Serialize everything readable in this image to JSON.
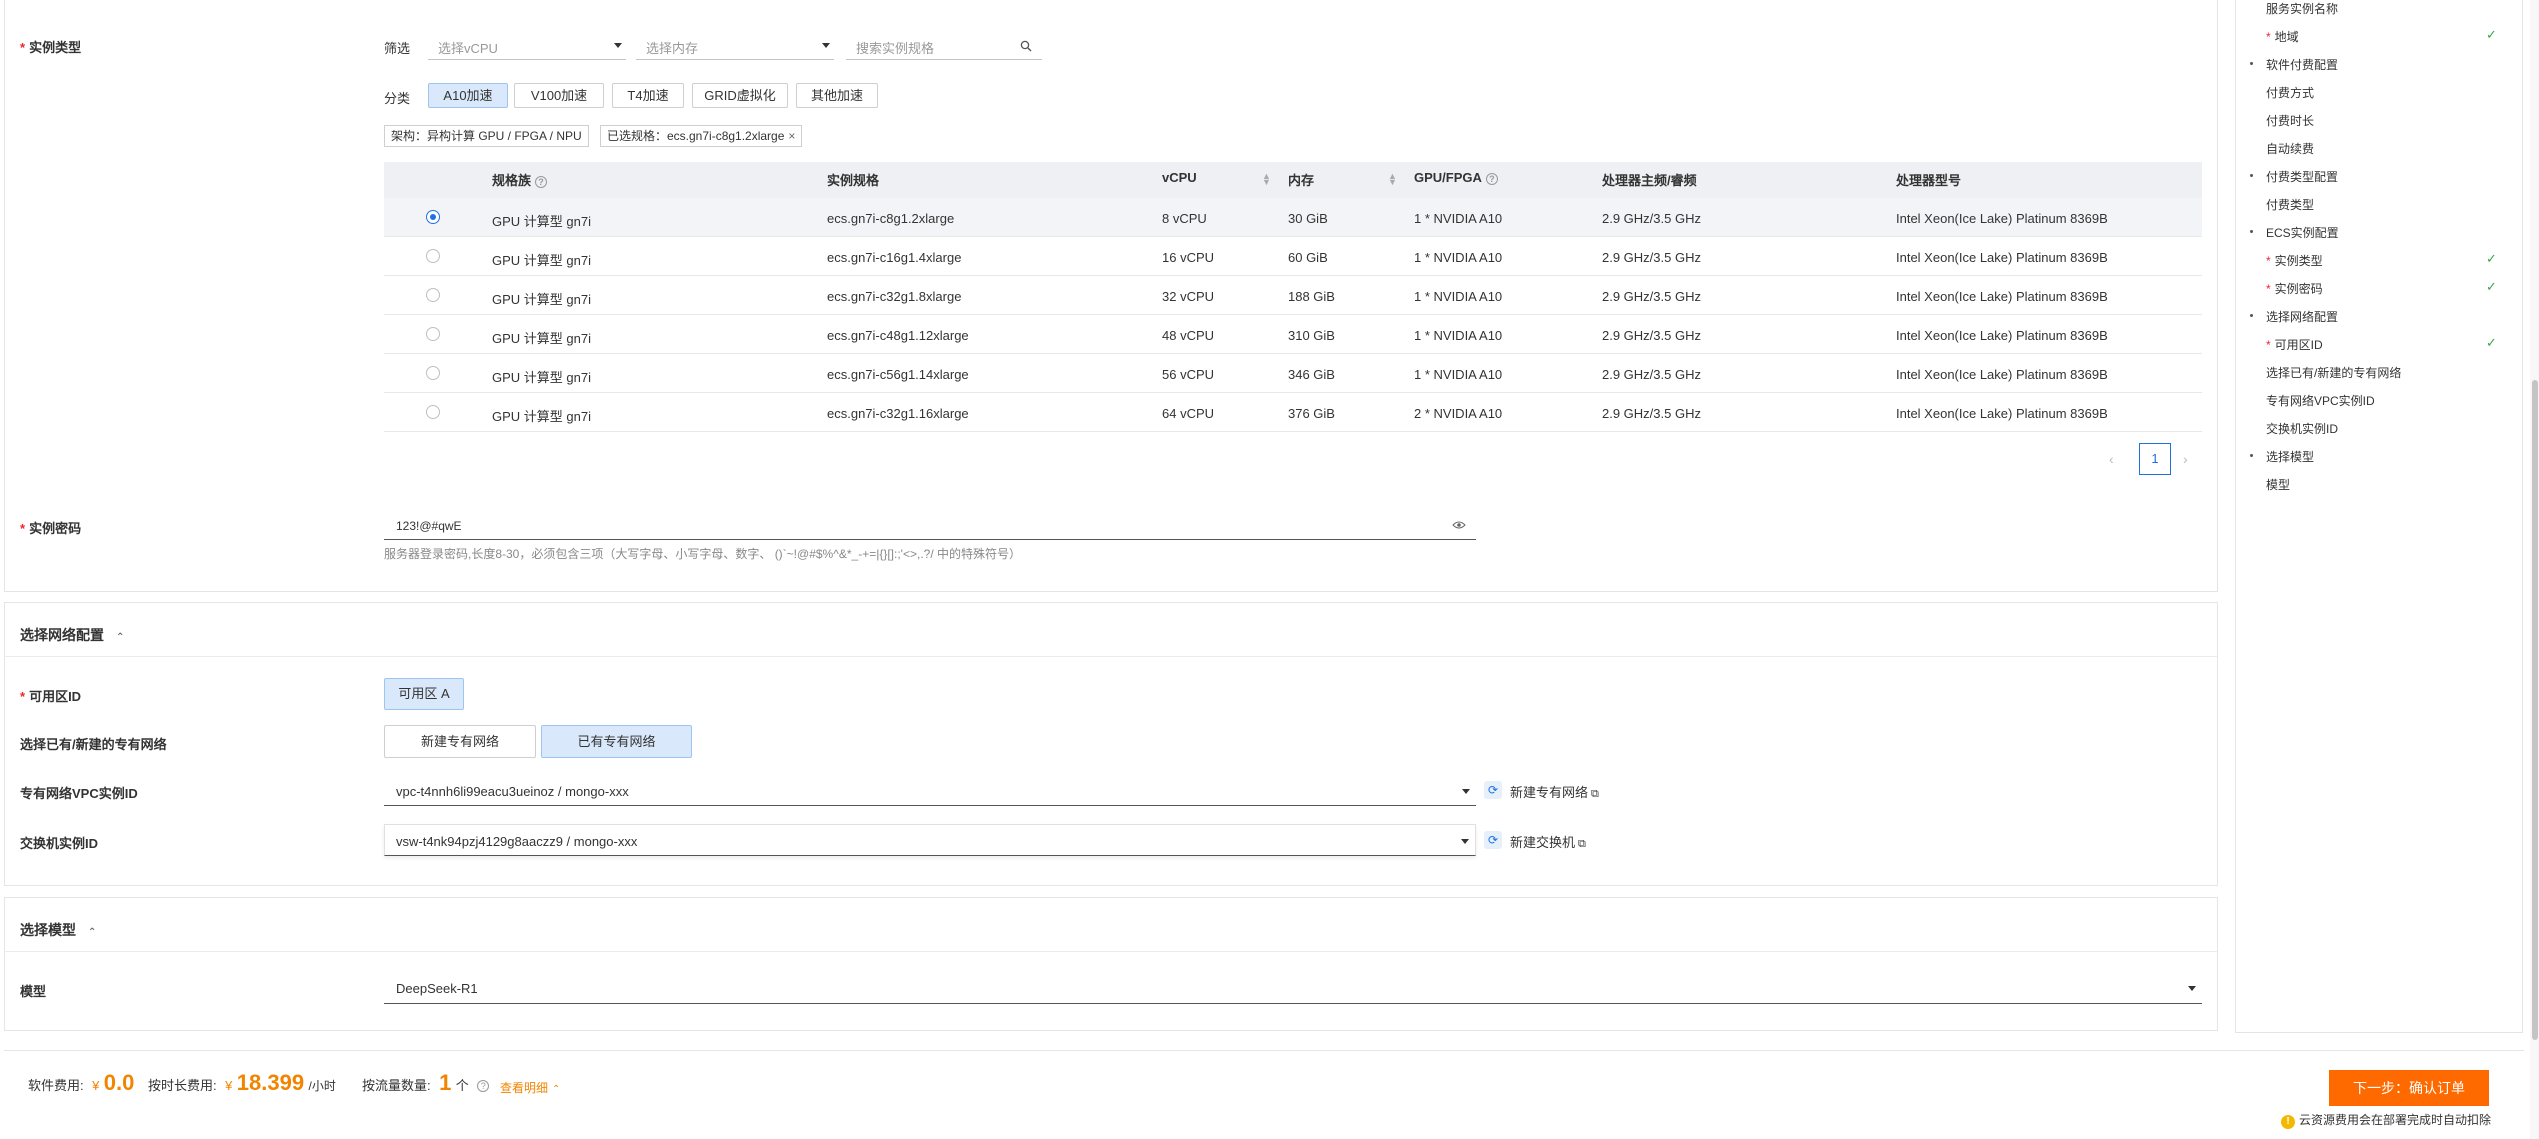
{
  "instance_type": {
    "label": "实例类型",
    "filter_label": "筛选",
    "vcpu_placeholder": "选择vCPU",
    "memory_placeholder": "选择内存",
    "search_placeholder": "搜索实例规格",
    "category_label": "分类",
    "categories": [
      "A10加速",
      "V100加速",
      "T4加速",
      "GRID虚拟化",
      "其他加速"
    ],
    "arch_tag": "架构：异构计算 GPU / FPGA / NPU",
    "selected_tag": "已选规格：ecs.gn7i-c8g1.2xlarge",
    "columns": [
      "规格族",
      "实例规格",
      "vCPU",
      "内存",
      "GPU/FPGA",
      "处理器主频/睿频",
      "处理器型号"
    ],
    "rows": [
      [
        "GPU 计算型 gn7i",
        "ecs.gn7i-c8g1.2xlarge",
        "8 vCPU",
        "30 GiB",
        "1 * NVIDIA A10",
        "2.9 GHz/3.5 GHz",
        "Intel Xeon(Ice Lake) Platinum 8369B"
      ],
      [
        "GPU 计算型 gn7i",
        "ecs.gn7i-c16g1.4xlarge",
        "16 vCPU",
        "60 GiB",
        "1 * NVIDIA A10",
        "2.9 GHz/3.5 GHz",
        "Intel Xeon(Ice Lake) Platinum 8369B"
      ],
      [
        "GPU 计算型 gn7i",
        "ecs.gn7i-c32g1.8xlarge",
        "32 vCPU",
        "188 GiB",
        "1 * NVIDIA A10",
        "2.9 GHz/3.5 GHz",
        "Intel Xeon(Ice Lake) Platinum 8369B"
      ],
      [
        "GPU 计算型 gn7i",
        "ecs.gn7i-c48g1.12xlarge",
        "48 vCPU",
        "310 GiB",
        "1 * NVIDIA A10",
        "2.9 GHz/3.5 GHz",
        "Intel Xeon(Ice Lake) Platinum 8369B"
      ],
      [
        "GPU 计算型 gn7i",
        "ecs.gn7i-c56g1.14xlarge",
        "56 vCPU",
        "346 GiB",
        "1 * NVIDIA A10",
        "2.9 GHz/3.5 GHz",
        "Intel Xeon(Ice Lake) Platinum 8369B"
      ],
      [
        "GPU 计算型 gn7i",
        "ecs.gn7i-c32g1.16xlarge",
        "64 vCPU",
        "376 GiB",
        "2 * NVIDIA A10",
        "2.9 GHz/3.5 GHz",
        "Intel Xeon(Ice Lake) Platinum 8369B"
      ]
    ],
    "page": "1"
  },
  "password": {
    "label": "实例密码",
    "value": "123!@#qwE",
    "hint": "服务器登录密码,长度8-30，必须包含三项（大写字母、小写字母、数字、 ()`~!@#$%^&*_-+=|{}[]:;'<>,.?/ 中的特殊符号）"
  },
  "network": {
    "title": "选择网络配置",
    "zone_label": "可用区ID",
    "zone_value": "可用区 A",
    "vpc_choice_label": "选择已有/新建的专有网络",
    "vpc_new": "新建专有网络",
    "vpc_existing": "已有专有网络",
    "vpc_id_label": "专有网络VPC实例ID",
    "vpc_id_value": "vpc-t4nnh6li99eacu3ueinoz / mongo-xxx",
    "vpc_create_link": "新建专有网络",
    "vswitch_label": "交换机实例ID",
    "vswitch_value": "vsw-t4nk94pzj4129g8aaczz9 / mongo-xxx",
    "vswitch_create_link": "新建交换机"
  },
  "model": {
    "title": "选择模型",
    "label": "模型",
    "value": "DeepSeek-R1"
  },
  "footer": {
    "software_fee_label": "软件费用:",
    "software_fee_currency": "¥",
    "software_fee": "0.0",
    "hourly_label": "按时长费用:",
    "hourly_currency": "¥",
    "hourly_fee": "18.399",
    "hourly_unit": "/小时",
    "traffic_label": "按流量数量:",
    "traffic_count": "1",
    "traffic_unit": "个",
    "details_link": "查看明细",
    "next_button": "下一步：确认订单",
    "notice": "云资源费用会在部署完成时自动扣除"
  },
  "sidebar": {
    "items": [
      {
        "label": "服务实例名称",
        "level": 1,
        "required": false,
        "done": false
      },
      {
        "label": "地域",
        "level": 1,
        "required": true,
        "done": true
      },
      {
        "label": "软件付费配置",
        "level": 0,
        "required": false,
        "done": false
      },
      {
        "label": "付费方式",
        "level": 1,
        "required": false,
        "done": false
      },
      {
        "label": "付费时长",
        "level": 1,
        "required": false,
        "done": false
      },
      {
        "label": "自动续费",
        "level": 1,
        "required": false,
        "done": false
      },
      {
        "label": "付费类型配置",
        "level": 0,
        "required": false,
        "done": false
      },
      {
        "label": "付费类型",
        "level": 1,
        "required": false,
        "done": false
      },
      {
        "label": "ECS实例配置",
        "level": 0,
        "required": false,
        "done": false
      },
      {
        "label": "实例类型",
        "level": 1,
        "required": true,
        "done": true
      },
      {
        "label": "实例密码",
        "level": 1,
        "required": true,
        "done": true
      },
      {
        "label": "选择网络配置",
        "level": 0,
        "required": false,
        "done": false
      },
      {
        "label": "可用区ID",
        "level": 1,
        "required": true,
        "done": true
      },
      {
        "label": "选择已有/新建的专有网络",
        "level": 1,
        "required": false,
        "done": false
      },
      {
        "label": "专有网络VPC实例ID",
        "level": 1,
        "required": false,
        "done": false
      },
      {
        "label": "交换机实例ID",
        "level": 1,
        "required": false,
        "done": false
      },
      {
        "label": "选择模型",
        "level": 0,
        "required": false,
        "done": false
      },
      {
        "label": "模型",
        "level": 1,
        "required": false,
        "done": false
      }
    ]
  },
  "colors": {
    "accent": "#1f6fe5",
    "price": "#f28500",
    "primary_button": "#ff6a00",
    "check": "#3aa64b",
    "required": "#f5222d"
  }
}
